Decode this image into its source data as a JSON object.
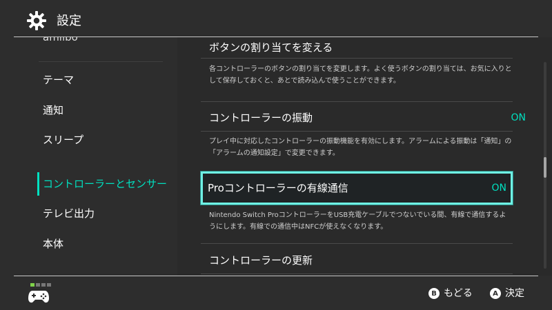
{
  "header": {
    "title": "設定",
    "icon": "gear-icon"
  },
  "sidebar": {
    "items": [
      {
        "label": "amiibo",
        "state": "partially-visible"
      },
      {
        "label": "テーマ"
      },
      {
        "label": "通知"
      },
      {
        "label": "スリープ"
      },
      {
        "label": "コントローラーとセンサー",
        "active": true
      },
      {
        "label": "テレビ出力"
      },
      {
        "label": "本体"
      }
    ]
  },
  "settings": [
    {
      "title": "ボタンの割り当てを変える",
      "value": "",
      "description": "各コントローラーのボタンの割り当てを変更します。よく使うボタンの割り当ては、お気に入りとして保存しておくと、あとで読み込んで使うことができます。"
    },
    {
      "title": "コントローラーの振動",
      "value": "ON",
      "description": "プレイ中に対応したコントローラーの振動機能を有効にします。アラームによる振動は「通知」の「アラームの通知設定」で変更できます。"
    },
    {
      "title": "Proコントローラーの有線通信",
      "value": "ON",
      "selected": true,
      "description": "Nintendo Switch ProコントローラーをUSB充電ケーブルでつないでいる間、有線で通信するようにします。有線での通信中はNFCが使えなくなります。"
    },
    {
      "title": "コントローラーの更新",
      "value": "",
      "description": ""
    }
  ],
  "footer": {
    "player_indicator": {
      "active": 1,
      "total": 4
    },
    "controller_icon": "controller-icon",
    "back": {
      "button": "B",
      "label": "もどる"
    },
    "confirm": {
      "button": "A",
      "label": "決定"
    }
  },
  "colors": {
    "background": "#2d2d2d",
    "accent": "#00e0c0",
    "selection_border": "#6ff0e4",
    "text": "#ffffff",
    "description_text": "#cfcfcf"
  }
}
